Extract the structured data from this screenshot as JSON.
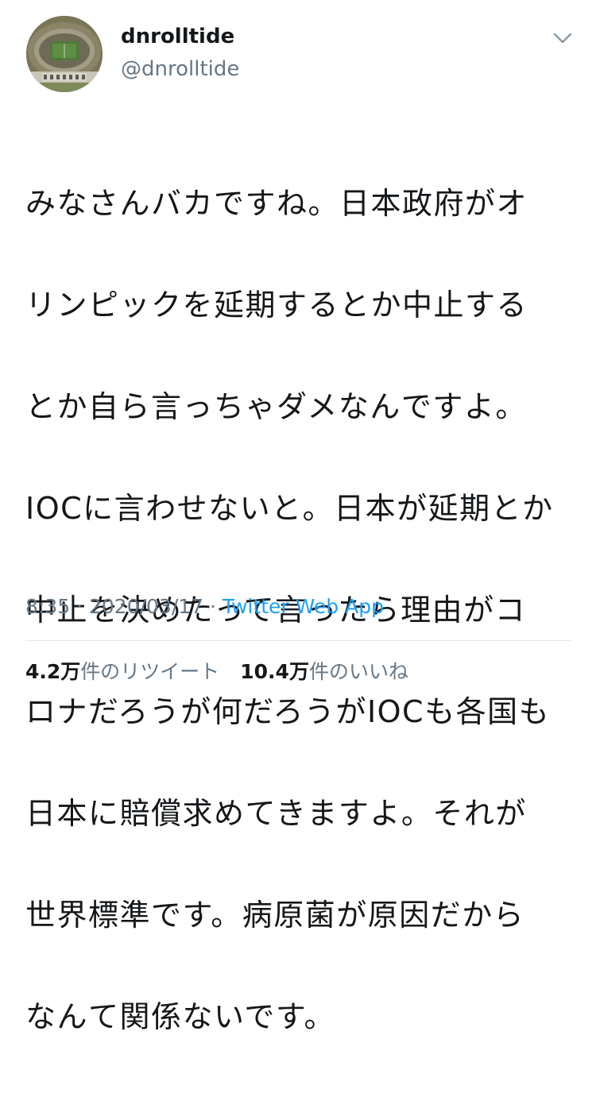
{
  "user": {
    "display_name": "dnrolltide",
    "handle": "@dnrolltide",
    "avatar_icon": "stadium-avatar"
  },
  "menu": {
    "icon": "chevron-down-icon"
  },
  "tweet": {
    "lines": [
      "みなさんバカですね。日本政府がオ",
      "リンピックを延期するとか中止する",
      "とか自ら言っちゃダメなんですよ。",
      "IOCに言わせないと。日本が延期とか",
      "中止を決めたって言ったら理由がコ",
      "ロナだろうが何だろうがIOCも各国も",
      "日本に賠償求めてきますよ。それが",
      "世界標準です。病原菌が原因だから",
      "なんて関係ないです。"
    ]
  },
  "meta": {
    "time": "8:35",
    "separator1": " · ",
    "date": "2020/03/17",
    "separator2": " · ",
    "source": "Twitter Web App"
  },
  "stats": {
    "retweets_count": "4.2万",
    "retweets_label": "件のリツイート",
    "likes_count": "10.4万",
    "likes_label": "件のいいね"
  },
  "colors": {
    "text": "#14171a",
    "secondary": "#657786",
    "link": "#1da1f2",
    "divider": "#e1e8ed"
  }
}
